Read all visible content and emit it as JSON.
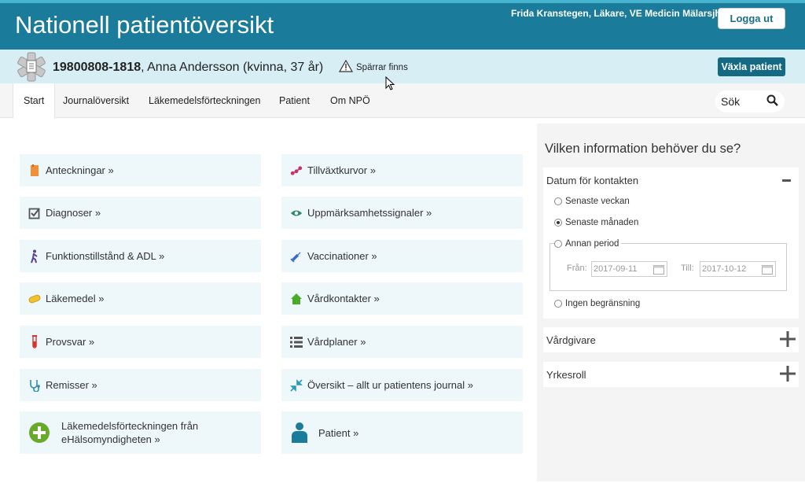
{
  "header": {
    "title": "Nationell patientöversikt",
    "user": "Frida Kranstegen, Läkare, VE Medicin Mälarsjh",
    "logout_label": "Logga ut"
  },
  "patient": {
    "personnummer": "19800808-1818",
    "details": ", Anna Andersson (kvinna, 37 år)",
    "warning": "Spärrar finns",
    "switch_label": "Växla patient"
  },
  "nav": {
    "tabs": [
      "Start",
      "Journalöversikt",
      "Läkemedelsförteckningen",
      "Patient",
      "Om NPÖ"
    ],
    "search_label": "Sök"
  },
  "tiles": {
    "left": [
      {
        "label": "Anteckningar »",
        "icon": "notes-icon",
        "color": "#f0913a"
      },
      {
        "label": "Diagnoser »",
        "icon": "checkbox-icon",
        "color": "#555555"
      },
      {
        "label": "Funktionstillstånd & ADL »",
        "icon": "walking-person-icon",
        "color": "#5a3f9a"
      },
      {
        "label": "Läkemedel »",
        "icon": "pill-icon",
        "color": "#f2c12e"
      },
      {
        "label": "Provsvar »",
        "icon": "test-tube-icon",
        "color": "#d9342b"
      },
      {
        "label": "Remisser »",
        "icon": "stethoscope-icon",
        "color": "#2a8fa8"
      },
      {
        "label": "Läkemedelsförteckningen från eHälsomyndigheten »",
        "icon": "plus-circle-icon",
        "color": "#6aaa2a"
      }
    ],
    "right": [
      {
        "label": "Tillväxtkurvor »",
        "icon": "growth-curve-icon",
        "color": "#c2336b"
      },
      {
        "label": "Uppmärksamhetssignaler »",
        "icon": "eye-icon",
        "color": "#2a8a6a"
      },
      {
        "label": "Vaccinationer »",
        "icon": "syringe-icon",
        "color": "#3a6ad0"
      },
      {
        "label": "Vårdkontakter »",
        "icon": "house-icon",
        "color": "#4aaa2a"
      },
      {
        "label": "Vårdplaner »",
        "icon": "list-icon",
        "color": "#555555"
      },
      {
        "label": "Översikt – allt ur patientens journal »",
        "icon": "expand-icon",
        "color": "#2a9ab8"
      },
      {
        "label": "Patient »",
        "icon": "person-icon",
        "color": "#1b7b9a"
      }
    ]
  },
  "sidebar": {
    "title": "Vilken information behöver du se?",
    "date_panel": {
      "label": "Datum för kontakten",
      "options": [
        "Senaste veckan",
        "Senaste månaden",
        "Annan period",
        "Ingen begränsning"
      ],
      "selected": "Senaste månaden",
      "from_label": "Från:",
      "from_value": "2017-09-11",
      "to_label": "Till:",
      "to_value": "2017-10-12"
    },
    "care_giver_label": "Vårdgivare",
    "profession_label": "Yrkesroll"
  }
}
